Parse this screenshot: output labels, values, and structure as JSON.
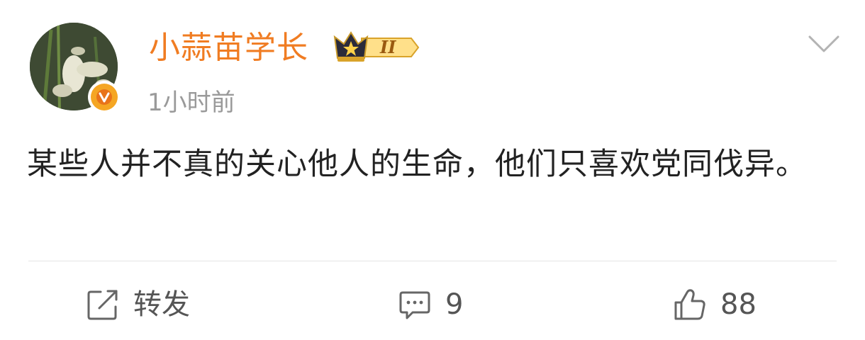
{
  "post": {
    "author": {
      "name": "小蒜苗学长",
      "level_badge": "II",
      "verified": true
    },
    "timestamp": "1小时前",
    "text": "某些人并不真的关心他人的生命，他们只喜欢党同伐异。"
  },
  "actions": {
    "repost_label": "转发",
    "comment_count": "9",
    "like_count": "88"
  },
  "icons": {
    "avatar": "garlic-sprout-photo",
    "verified": "verified-v-icon",
    "level": "crown-level-icon",
    "menu": "chevron-down-icon",
    "repost": "repost-icon",
    "comment": "comment-icon",
    "like": "thumbs-up-icon"
  },
  "colors": {
    "username": "#f07c22",
    "verified": "#f5a623",
    "timestamp": "#9a9a9a",
    "text": "#222222",
    "action": "#555555"
  }
}
